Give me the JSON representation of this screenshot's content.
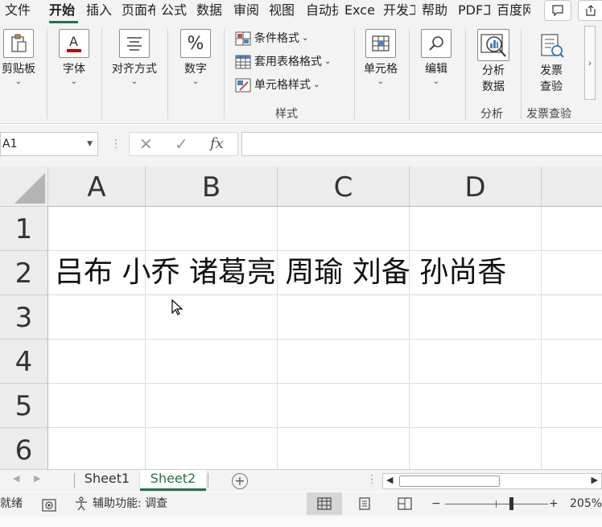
{
  "menu": {
    "tabs": [
      "文件",
      "开始",
      "插入",
      "页面布",
      "公式",
      "数据",
      "审阅",
      "视图",
      "自动执",
      "Excel",
      "开发工",
      "帮助",
      "PDF工",
      "百度网"
    ],
    "active_tab": "开始"
  },
  "ribbon": {
    "clipboard_label": "剪贴板",
    "font_label": "字体",
    "alignment_label": "对齐方式",
    "number_label": "数字",
    "conditional_format": "条件格式",
    "format_as_table": "套用表格格式",
    "cell_styles": "单元格样式",
    "styles_group": "样式",
    "cells_label": "单元格",
    "editing_label": "编辑",
    "analyze_data_line1": "分析",
    "analyze_data_line2": "数据",
    "analysis_group": "分析",
    "invoice_line1": "发票",
    "invoice_line2": "查验",
    "invoice_group": "发票查验"
  },
  "formula_bar": {
    "name_box": "A1",
    "formula": ""
  },
  "grid": {
    "columns": [
      "A",
      "B",
      "C",
      "D"
    ],
    "rows": [
      "1",
      "2",
      "3",
      "4",
      "5",
      "6"
    ],
    "cell_a2": "吕布 小乔 诸葛亮 周瑜 刘备 孙尚香"
  },
  "sheets": {
    "tabs": [
      "Sheet1",
      "Sheet2"
    ],
    "active": "Sheet2",
    "add_label": "+"
  },
  "status": {
    "ready": "就绪",
    "accessibility": "辅助功能: 调查",
    "zoom_minus": "−",
    "zoom_plus": "+",
    "zoom": "205%"
  },
  "colors": {
    "accent": "#217346",
    "ribbon_bg": "#f3f3f3",
    "header_bg": "#ececec",
    "gridline": "#dcdcdc"
  },
  "icons": [
    "clipboard-icon",
    "font-color-icon",
    "align-icon",
    "percent-icon",
    "conditional-format-icon",
    "table-format-icon",
    "cell-style-icon",
    "cells-icon",
    "search-icon",
    "analyze-data-icon",
    "invoice-icon",
    "comment-icon",
    "share-icon",
    "cancel-icon",
    "check-icon",
    "function-icon",
    "macro-record-icon",
    "accessibility-icon",
    "normal-view-icon",
    "page-layout-icon",
    "page-break-icon"
  ]
}
